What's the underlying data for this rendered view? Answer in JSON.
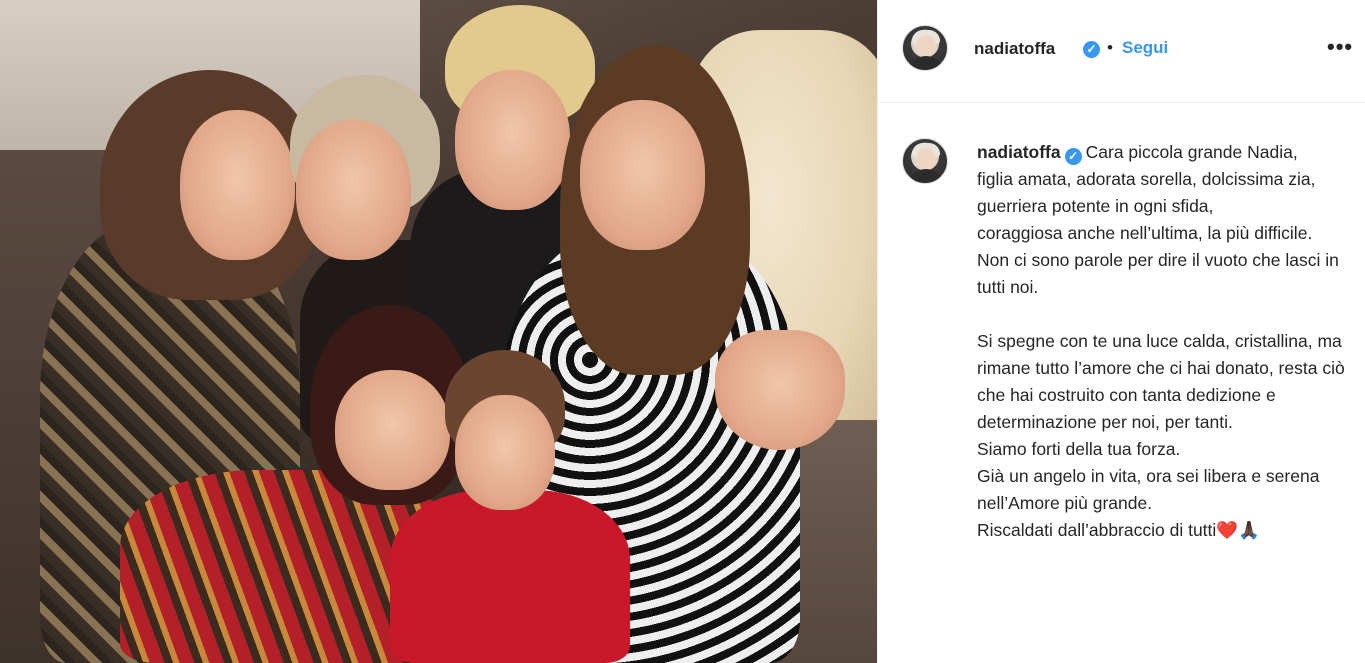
{
  "post": {
    "username": "nadiatoffa",
    "verified_icon": "verified-badge-icon",
    "separator": "•",
    "follow_label": "Segui",
    "more_label": "•••"
  },
  "caption": {
    "username": "nadiatoffa",
    "text": "Cara piccola grande Nadia,\nfiglia amata, adorata sorella, dolcissima zia,\nguerriera potente in ogni sfida,\ncoraggiosa anche nell’ultima, la più difficile.\nNon ci sono parole per dire il vuoto che lasci in tutti noi.\n\nSi spegne con te una luce calda, cristallina, ma rimane tutto l’amore che ci hai donato, resta ciò che hai costruito con tanta dedizione e determinazione per noi, per tanti.\nSiamo forti della tua forza.\nGià un angelo in vita, ora sei libera e serena nell’Amore più grande.\nRiscaldati dall’abbraccio di tutti❤️🙏🏿"
  },
  "colors": {
    "link_blue": "#3897f0",
    "text": "#262626",
    "divider": "#efefef"
  }
}
